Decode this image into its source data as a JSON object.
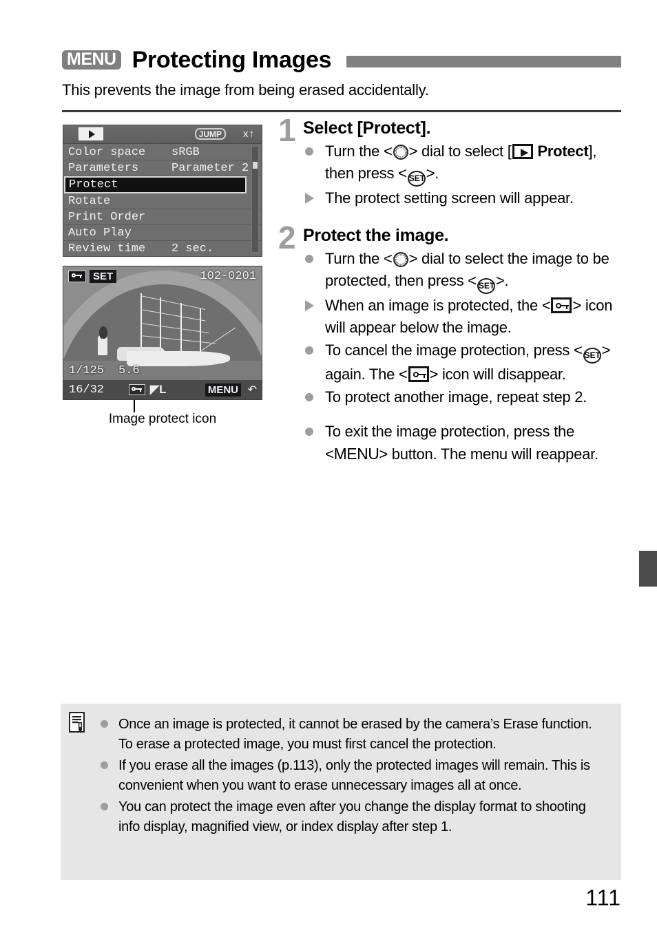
{
  "header": {
    "menu_badge": "MENU",
    "title": "Protecting Images",
    "lede": "This prevents the image from being erased accidentally."
  },
  "figures": {
    "menu_screen": {
      "tab_icon": "playback-icon",
      "jump_badge": "JUMP",
      "tools_icons": "wrench-tools-icon",
      "rows": [
        {
          "label": "Color space",
          "value": "sRGB",
          "selected": false
        },
        {
          "label": "Parameters",
          "value": "Parameter 2",
          "selected": false
        },
        {
          "label": "Protect",
          "value": "",
          "selected": true
        },
        {
          "label": "Rotate",
          "value": "",
          "selected": false
        },
        {
          "label": "Print Order",
          "value": "",
          "selected": false
        },
        {
          "label": "Auto Play",
          "value": "",
          "selected": false
        },
        {
          "label": "Review time",
          "value": "2 sec.",
          "selected": false
        }
      ]
    },
    "photo_screen": {
      "protect_badge_icon": "key-protect-icon",
      "set_badge": "SET",
      "file_number": "102-0201",
      "shutter_speed": "1/125",
      "aperture": "5.6",
      "image_count": "16/32",
      "quality": "L",
      "menu_badge": "MENU",
      "back_icon": "return-arrow-icon"
    },
    "caption": "Image protect icon"
  },
  "steps": [
    {
      "number": "1",
      "heading": "Select [Protect].",
      "bullets": [
        {
          "marker": "dot",
          "parts": [
            {
              "t": "text",
              "v": "Turn the <"
            },
            {
              "t": "icon",
              "v": "dial"
            },
            {
              "t": "text",
              "v": "> dial to select ["
            },
            {
              "t": "icon",
              "v": "play"
            },
            {
              "t": "bold",
              "v": " Protect"
            },
            {
              "t": "text",
              "v": "], then press <"
            },
            {
              "t": "icon",
              "v": "set"
            },
            {
              "t": "text",
              "v": ">."
            }
          ]
        },
        {
          "marker": "tri",
          "parts": [
            {
              "t": "text",
              "v": "The protect setting screen will appear."
            }
          ]
        }
      ]
    },
    {
      "number": "2",
      "heading": "Protect the image.",
      "bullets": [
        {
          "marker": "dot",
          "parts": [
            {
              "t": "text",
              "v": "Turn the <"
            },
            {
              "t": "icon",
              "v": "dial"
            },
            {
              "t": "text",
              "v": "> dial to select the image to be protected, then press <"
            },
            {
              "t": "icon",
              "v": "set"
            },
            {
              "t": "text",
              "v": ">."
            }
          ]
        },
        {
          "marker": "tri",
          "parts": [
            {
              "t": "text",
              "v": "When an image is protected, the <"
            },
            {
              "t": "icon",
              "v": "key"
            },
            {
              "t": "text",
              "v": "> icon will appear below the image."
            }
          ]
        },
        {
          "marker": "dot",
          "parts": [
            {
              "t": "text",
              "v": "To cancel the image protection, press <"
            },
            {
              "t": "icon",
              "v": "set"
            },
            {
              "t": "text",
              "v": "> again. The <"
            },
            {
              "t": "icon",
              "v": "key"
            },
            {
              "t": "text",
              "v": "> icon will disappear."
            }
          ]
        },
        {
          "marker": "dot",
          "parts": [
            {
              "t": "text",
              "v": "To protect another image, repeat step 2."
            }
          ]
        },
        {
          "marker": "dot",
          "spaced": true,
          "parts": [
            {
              "t": "text",
              "v": "To exit the image protection, press the <"
            },
            {
              "t": "menuword",
              "v": "MENU"
            },
            {
              "t": "text",
              "v": "> button. The menu will reappear."
            }
          ]
        }
      ]
    }
  ],
  "note": {
    "icon": "memo-note-icon",
    "bullets": [
      "Once an image is protected, it cannot be erased by the camera’s Erase function. To erase a protected image, you must first cancel the protection.",
      "If you erase all the images (p.113), only the protected images will remain. This is convenient when you want to erase unnecessary images all at once.",
      "You can protect the image even after you change the display format to shooting info display, magnified view, or index display after step 1."
    ]
  },
  "page_number": "111",
  "colors": {
    "accent_gray": "#808080",
    "marker_gray": "#9d9d9d",
    "note_bg": "#e6e6e6",
    "tab_marker": "#4b4b4b"
  }
}
